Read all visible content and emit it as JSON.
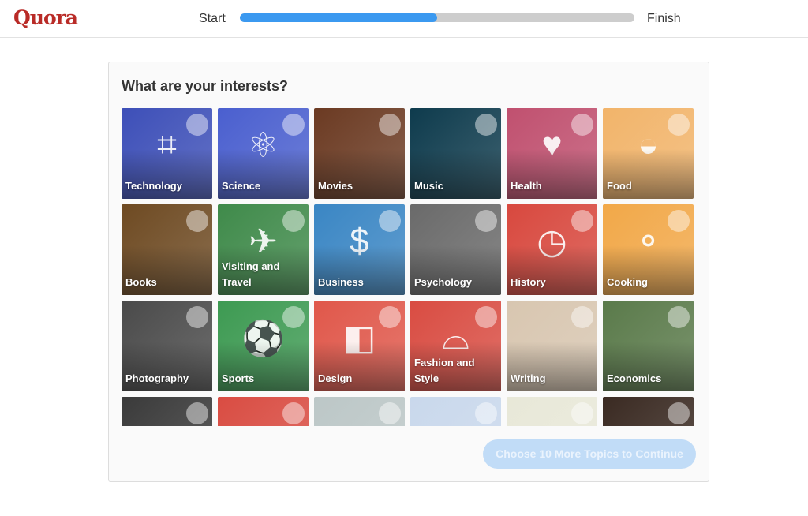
{
  "header": {
    "logo": "Quora",
    "start_label": "Start",
    "finish_label": "Finish",
    "progress_percent": 50
  },
  "main": {
    "title": "What are your interests?",
    "continue_button": "Choose 10 More Topics to Continue",
    "topics": [
      {
        "label": "Technology",
        "color": "#3d4fb8",
        "icon": "circuit-chip-icon"
      },
      {
        "label": "Science",
        "color": "#4a5fcf",
        "icon": "atom-icon"
      },
      {
        "label": "Movies",
        "color": "#6b3a22",
        "icon": "film-reel-icon"
      },
      {
        "label": "Music",
        "color": "#0e3b4d",
        "icon": "microphone-icon"
      },
      {
        "label": "Health",
        "color": "#c0506f",
        "icon": "heart-pulse-icon"
      },
      {
        "label": "Food",
        "color": "#f2b46a",
        "icon": "rice-bowl-icon"
      },
      {
        "label": "Books",
        "color": "#6e4a22",
        "icon": "books-icon"
      },
      {
        "label": "Visiting and Travel",
        "color": "#3f8a4a",
        "icon": "airplane-icon"
      },
      {
        "label": "Business",
        "color": "#3a86c4",
        "icon": "dollar-chart-icon"
      },
      {
        "label": "Psychology",
        "color": "#6a6a6a",
        "icon": "head-icon"
      },
      {
        "label": "History",
        "color": "#d8483e",
        "icon": "clock-history-icon"
      },
      {
        "label": "Cooking",
        "color": "#f2a848",
        "icon": "frying-pan-icon"
      },
      {
        "label": "Photography",
        "color": "#4a4a4a",
        "icon": "camera-icon"
      },
      {
        "label": "Sports",
        "color": "#3d9a52",
        "icon": "sports-balls-icon"
      },
      {
        "label": "Design",
        "color": "#e0574a",
        "icon": "design-shapes-icon"
      },
      {
        "label": "Fashion and Style",
        "color": "#d94c42",
        "icon": "hat-icon"
      },
      {
        "label": "Writing",
        "color": "#d8c6b0",
        "icon": "pen-icon"
      },
      {
        "label": "Economics",
        "color": "#5a7a4a",
        "icon": "coins-icon"
      },
      {
        "label": "",
        "color": "#3a3a3a",
        "icon": "chalkboard-icon"
      },
      {
        "label": "",
        "color": "#d94c42",
        "icon": "topic-icon"
      },
      {
        "label": "",
        "color": "#bcc7c7",
        "icon": "star-icon"
      },
      {
        "label": "",
        "color": "#c9d8ec",
        "icon": "document-icon"
      },
      {
        "label": "",
        "color": "#e8e8d8",
        "icon": "keyboard-icon"
      },
      {
        "label": "",
        "color": "#3a2a22",
        "icon": "people-icon"
      }
    ]
  }
}
